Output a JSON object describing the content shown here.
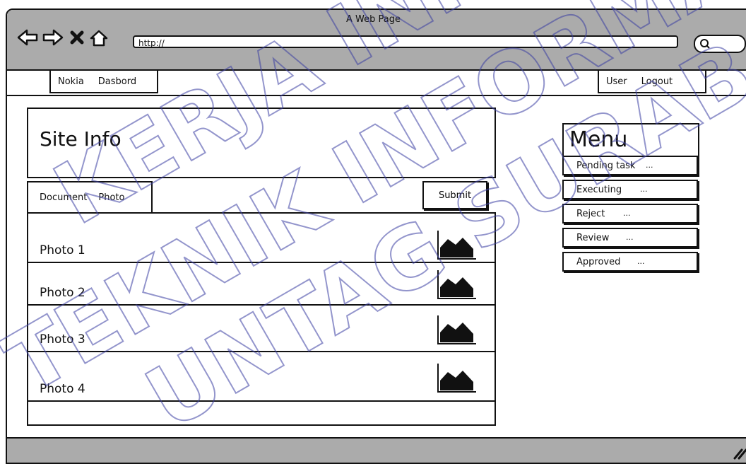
{
  "window": {
    "title": "A Web Page"
  },
  "browser": {
    "url": "http://",
    "nav_icons": [
      "back-arrow-icon",
      "forward-arrow-icon",
      "stop-icon",
      "home-icon"
    ]
  },
  "navbar": {
    "left_items": [
      "Nokia",
      "Dasbord"
    ],
    "right_items": [
      "User",
      "Logout"
    ]
  },
  "site_info": {
    "title": "Site Info"
  },
  "tabs": [
    "Document",
    "Photo"
  ],
  "submit_label": "Submit",
  "photos": [
    "Photo 1",
    "Photo 2",
    "Photo 3",
    "Photo 4"
  ],
  "menu": {
    "title": "Menu",
    "items": [
      {
        "label": "Pending task",
        "more": "..."
      },
      {
        "label": "Executing",
        "more": "..."
      },
      {
        "label": "Reject",
        "more": "..."
      },
      {
        "label": "Review",
        "more": "..."
      },
      {
        "label": "Approved",
        "more": "..."
      }
    ]
  },
  "watermark": {
    "lines": [
      "KERJA INFORMATIKA",
      "TEKNIK INFORMATIKA",
      "UNTAG SURABAYA"
    ],
    "color": "#3b3fa3"
  },
  "colors": {
    "chrome": "#ababab",
    "ink": "#111111"
  }
}
